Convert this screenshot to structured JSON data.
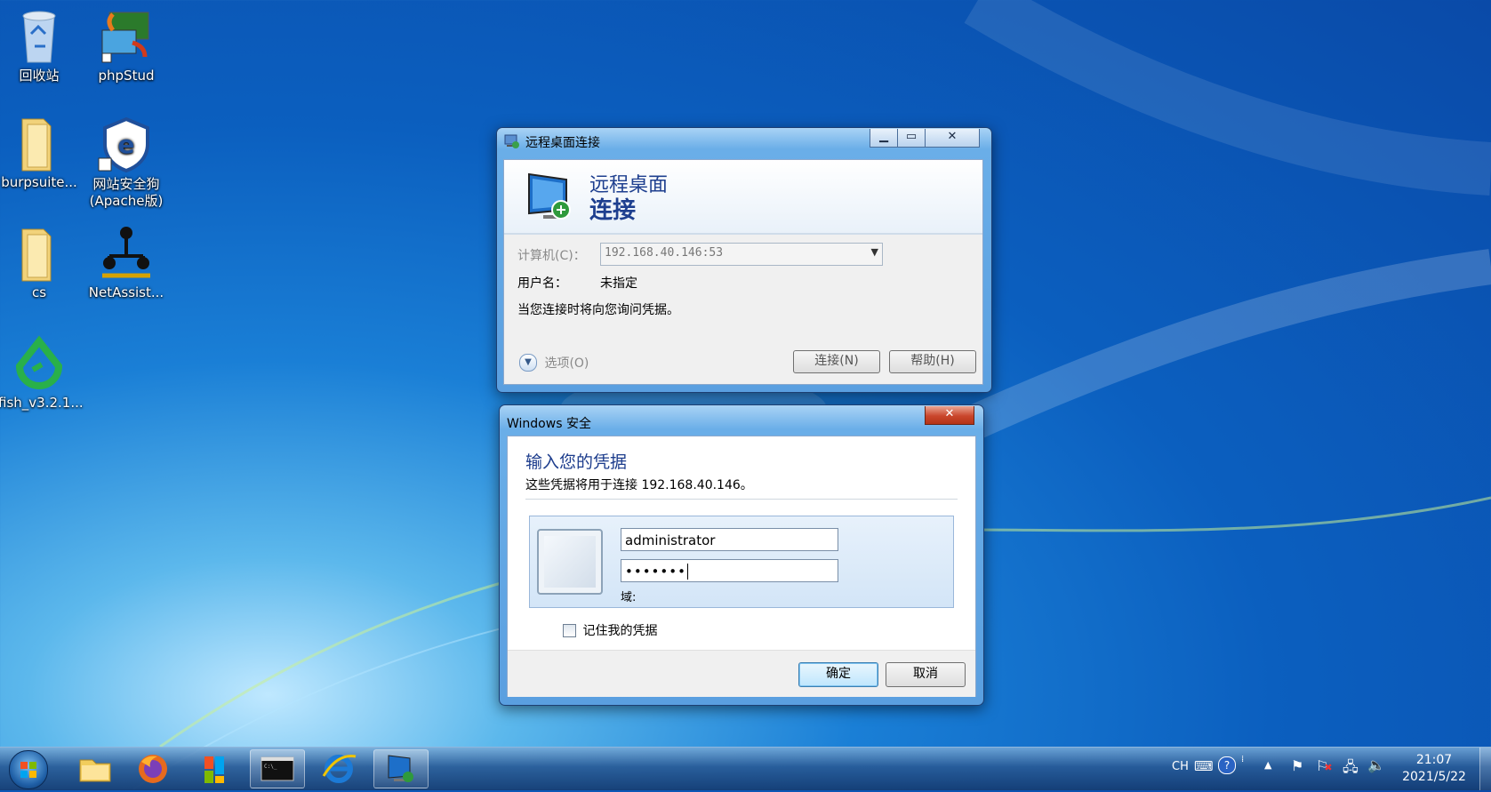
{
  "desktop": {
    "icons": [
      {
        "label": "回收站",
        "icon": "recycle-bin-icon"
      },
      {
        "label": "phpStud",
        "icon": "phpstudy-icon"
      },
      {
        "label": "burpsuite...",
        "icon": "folder-icon"
      },
      {
        "label": "网站安全狗(Apache版)",
        "icon": "safedog-icon"
      },
      {
        "label": "cs",
        "icon": "folder-icon"
      },
      {
        "label": "NetAssist...",
        "icon": "netassist-icon"
      },
      {
        "label": "fish_v3.2.1...",
        "icon": "fish-icon"
      }
    ]
  },
  "rdp_window": {
    "title": "远程桌面连接",
    "header_line1": "远程桌面",
    "header_line2": "连接",
    "computer_label": "计算机(C)：",
    "computer_value": "192.168.40.146:53",
    "username_label": "用户名：",
    "username_value": "未指定",
    "info_text": "当您连接时将向您询问凭据。",
    "options_label": "选项(O)",
    "connect_button": "连接(N)",
    "help_button": "帮助(H)"
  },
  "security_window": {
    "title": "Windows 安全",
    "heading": "输入您的凭据",
    "subtext": "这些凭据将用于连接 192.168.40.146。",
    "username_value": "administrator",
    "password_mask": "•••••••",
    "domain_label": "域:",
    "remember_label": "记住我的凭据",
    "ok_button": "确定",
    "cancel_button": "取消"
  },
  "taskbar": {
    "items": [
      "start",
      "explorer",
      "firefox",
      "store",
      "cmd",
      "ie",
      "rdp"
    ],
    "tray_lang": "CH",
    "clock_time": "21:07",
    "clock_date": "2021/5/22"
  }
}
